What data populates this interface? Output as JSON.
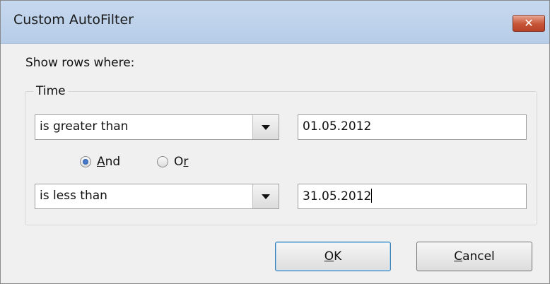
{
  "window": {
    "title": "Custom AutoFilter",
    "close_glyph": "✕"
  },
  "prompt": "Show rows where:",
  "group_label": "Time",
  "conditions": [
    {
      "operator": "is greater than",
      "value": "01.05.2012"
    },
    {
      "operator": "is less than",
      "value": "31.05.2012"
    }
  ],
  "logic": {
    "and_prefix": "",
    "and_underline": "A",
    "and_suffix": "nd",
    "or_prefix": "O",
    "or_underline": "r",
    "or_suffix": "",
    "selected": "And"
  },
  "buttons": {
    "ok_underline": "O",
    "ok_suffix": "K",
    "cancel_underline": "C",
    "cancel_suffix": "ancel"
  },
  "colors": {
    "titlebar": "#b7cde8",
    "close": "#c65435",
    "default_border": "#3c7fb1"
  }
}
